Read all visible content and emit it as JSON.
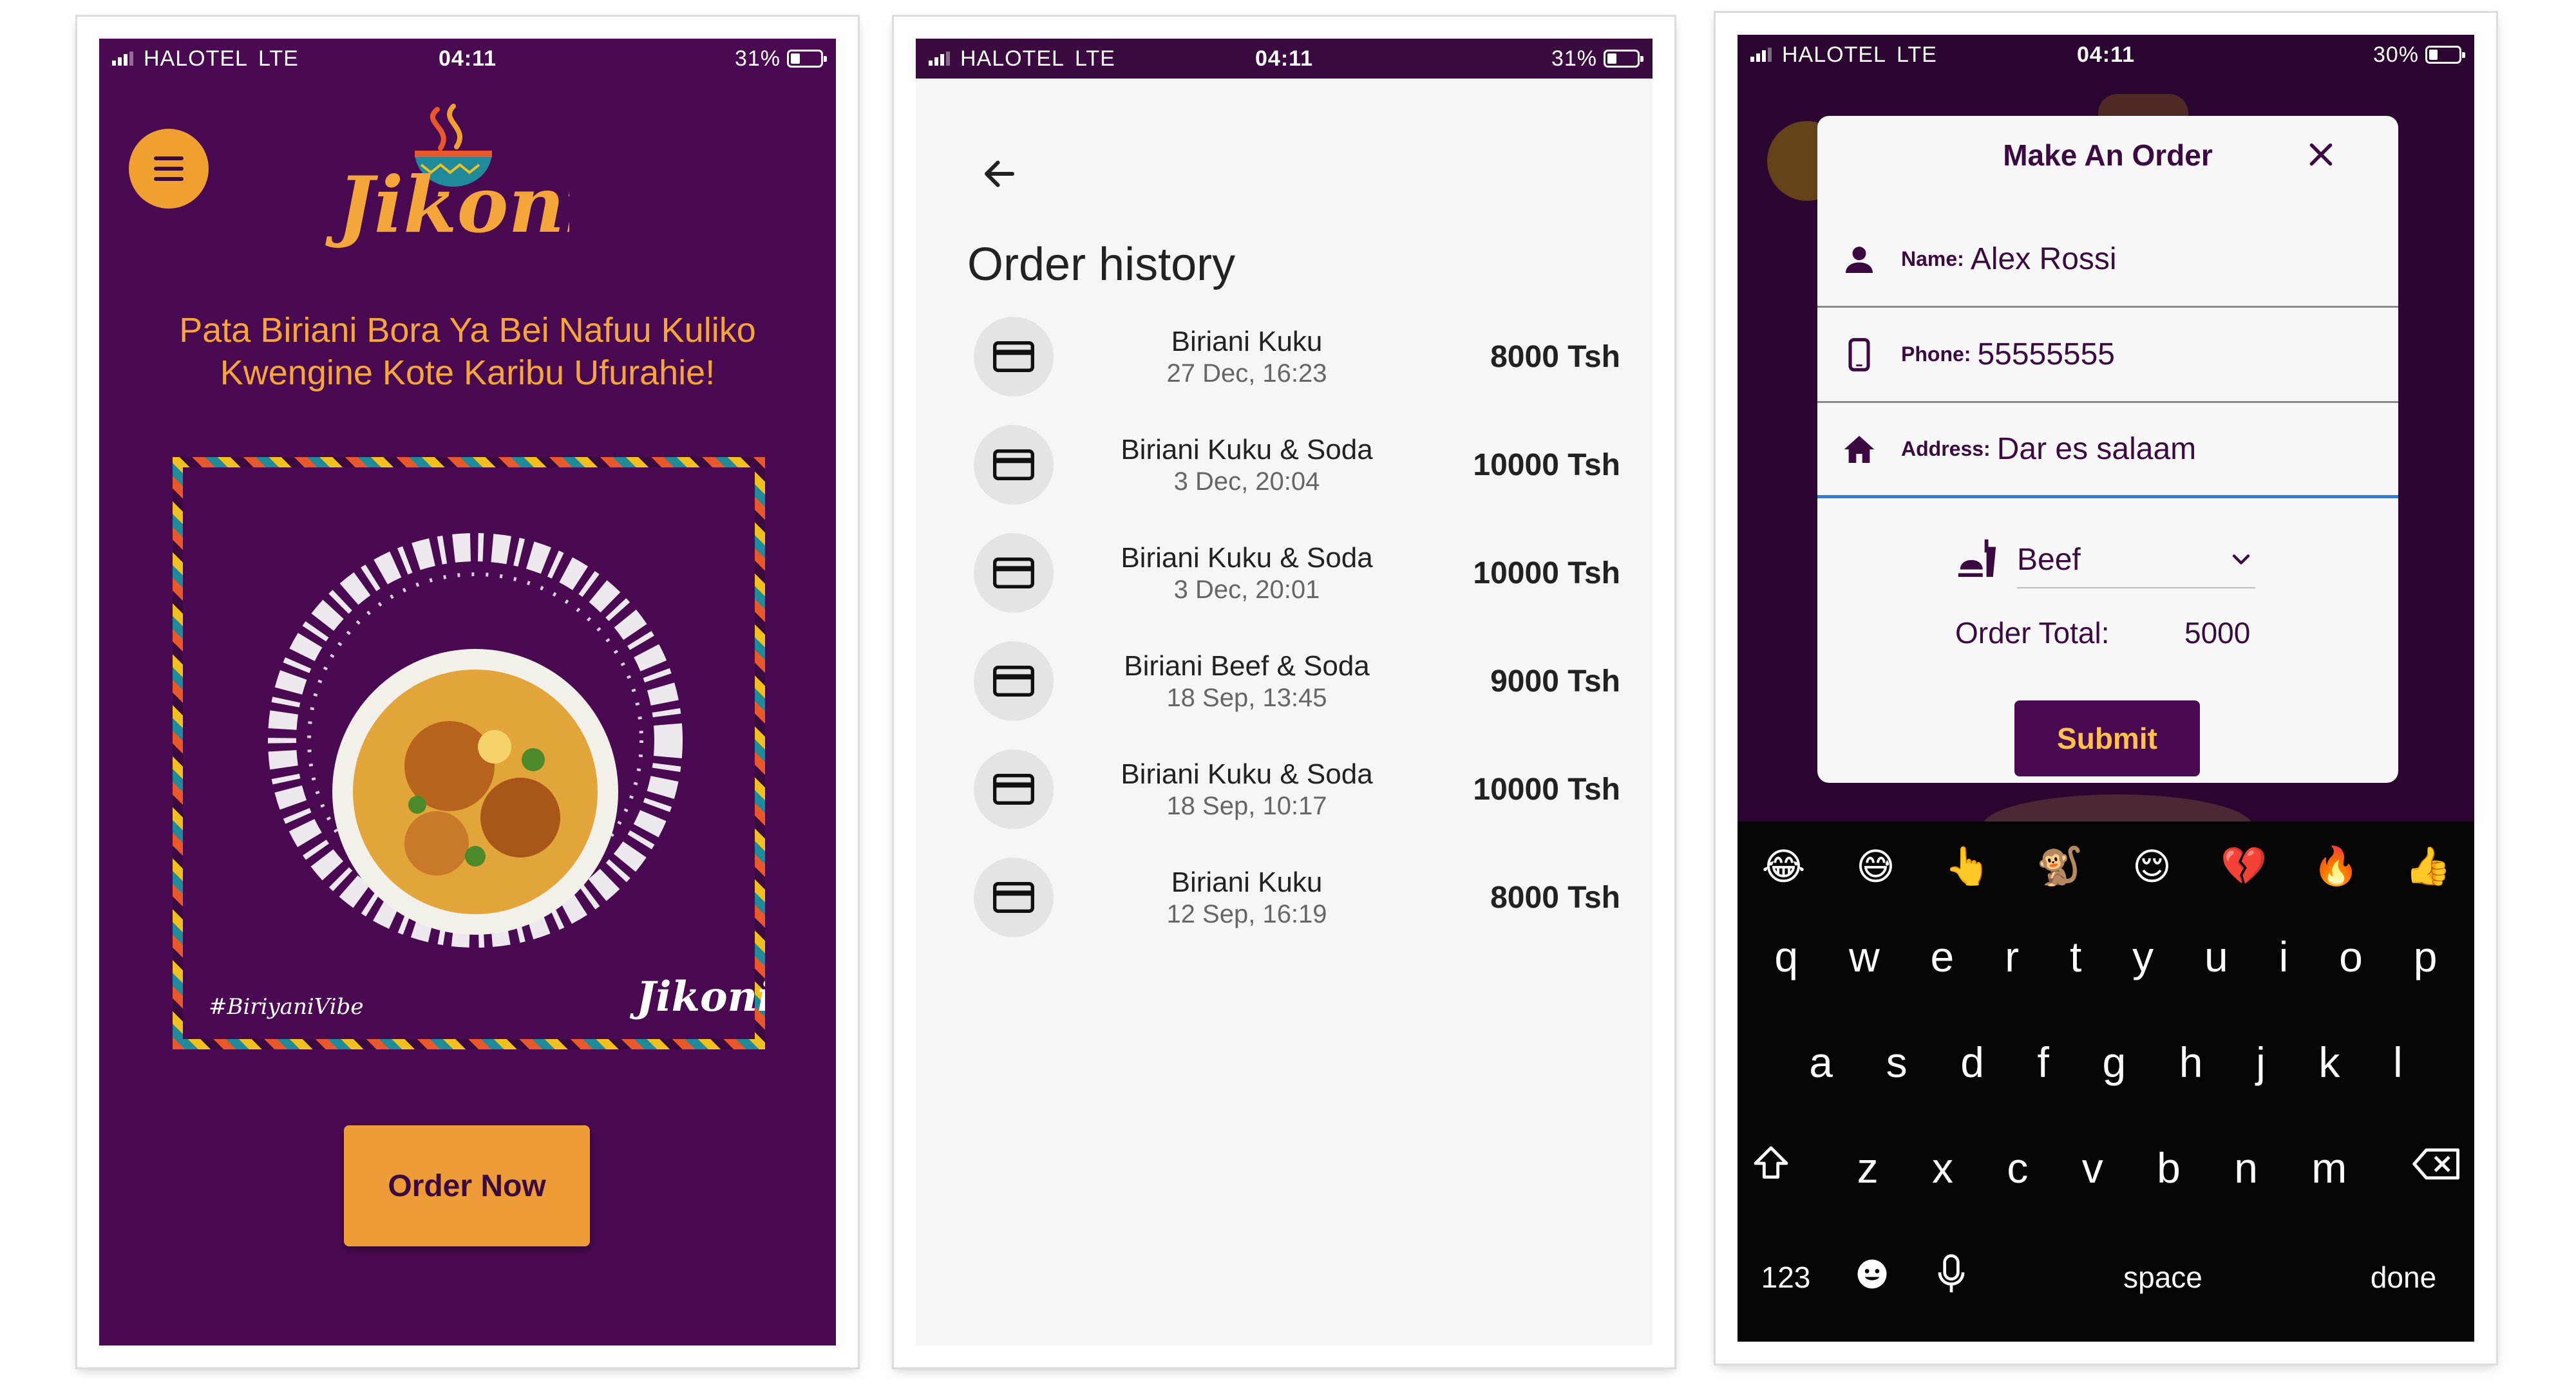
{
  "status": {
    "carrier": "HALOTEL",
    "network": "LTE",
    "time": "04:11",
    "battery_screen1": "31%",
    "battery_screen2": "31%",
    "battery_screen3": "30%",
    "battery_level_screen1": 0.31,
    "battery_level_screen2": 0.31,
    "battery_level_screen3": 0.3
  },
  "home": {
    "brand": "Jikoni",
    "tagline": "Pata Biriani Bora Ya Bei Nafuu Kuliko Kwengine Kote Karibu Ufurahie!",
    "poster_hashtag": "#BiriyaniVibe",
    "order_button": "Order Now",
    "menu_icon": "hamburger-icon"
  },
  "history": {
    "title": "Order history",
    "back_icon": "arrow-left-icon",
    "row_icon": "credit-card-icon",
    "orders": [
      {
        "name": "Biriani Kuku",
        "date": "27 Dec, 16:23",
        "price": "8000 Tsh"
      },
      {
        "name": "Biriani Kuku & Soda",
        "date": "3 Dec, 20:04",
        "price": "10000 Tsh"
      },
      {
        "name": "Biriani Kuku & Soda",
        "date": "3 Dec, 20:01",
        "price": "10000 Tsh"
      },
      {
        "name": "Biriani Beef & Soda",
        "date": "18 Sep, 13:45",
        "price": "9000 Tsh"
      },
      {
        "name": "Biriani Kuku & Soda",
        "date": "18 Sep, 10:17",
        "price": "10000 Tsh"
      },
      {
        "name": "Biriani Kuku",
        "date": "12 Sep, 16:19",
        "price": "8000 Tsh"
      }
    ]
  },
  "order_dialog": {
    "title": "Make An Order",
    "name_label": "Name:",
    "name_value": "Alex Rossi",
    "phone_label": "Phone:",
    "phone_value": "55555555",
    "address_label": "Address:",
    "address_value": "Dar es salaam",
    "meat_value": "Beef",
    "total_label": "Order Total:",
    "total_value": "5000",
    "submit_label": "Submit"
  },
  "keyboard": {
    "emojis": [
      "😂",
      "😅",
      "👆",
      "🐒",
      "😌",
      "💔",
      "🔥",
      "👍"
    ],
    "row1": [
      "q",
      "w",
      "e",
      "r",
      "t",
      "y",
      "u",
      "i",
      "o",
      "p"
    ],
    "row2": [
      "a",
      "s",
      "d",
      "f",
      "g",
      "h",
      "j",
      "k",
      "l"
    ],
    "row3": [
      "z",
      "x",
      "c",
      "v",
      "b",
      "n",
      "m"
    ],
    "numbers_key": "123",
    "space_key": "space",
    "done_key": "done"
  },
  "colors": {
    "brand_purple": "#4a0a52",
    "brand_orange": "#ee9c38",
    "accent_blue": "#2f7fd8"
  }
}
